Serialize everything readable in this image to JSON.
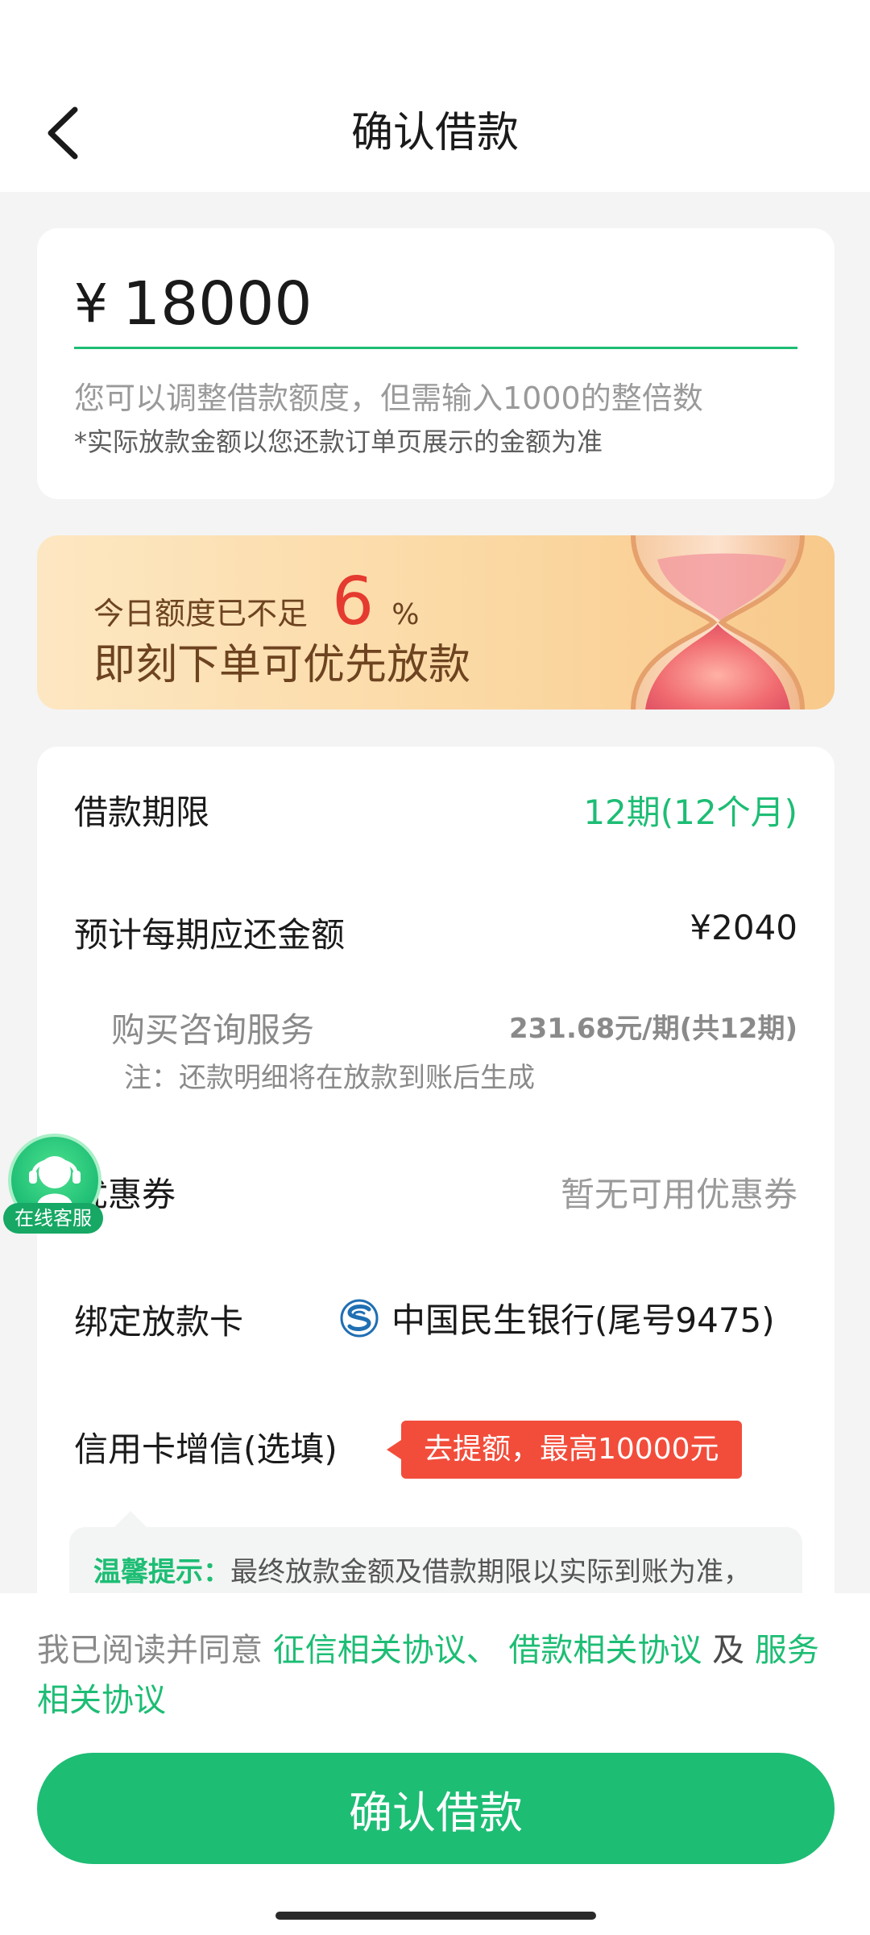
{
  "header": {
    "title": "确认借款"
  },
  "amount": {
    "currency": "¥",
    "value": "18000",
    "hint": "您可以调整借款额度，但需输入1000的整倍数",
    "note": "*实际放款金额以您还款订单页展示的金额为准"
  },
  "promo": {
    "line1": "今日额度已不足",
    "percent": "6",
    "percent_sign": "%",
    "line2": "即刻下单可优先放款"
  },
  "details": {
    "term_label": "借款期限",
    "term_value": "12期(12个月)",
    "monthly_label": "预计每期应还金额",
    "monthly_value": "¥2040",
    "service_label": "购买咨询服务",
    "service_value": "231.68元/期(共12期)",
    "service_note": "注：还款明细将在放款到账后生成",
    "coupon_label": "优惠券",
    "coupon_value": "暂无可用优惠券",
    "card_label": "绑定放款卡",
    "card_value": "中国民生银行(尾号9475)",
    "credit_label": "信用卡增信(选填)",
    "credit_tag": "去提额，最高10000元",
    "tip_label": "温馨提示：",
    "tip_text": "最终放款金额及借款期限以实际到账为准，"
  },
  "float_service": {
    "label": "在线客服"
  },
  "agreement": {
    "prefix": "我已阅读并同意",
    "link1": "征信相关协议、",
    "link2": "借款相关协议",
    "joiner": "及",
    "link3": "服务相关协议"
  },
  "confirm_button": {
    "label": "确认借款"
  },
  "colors": {
    "accent": "#1dbd74",
    "warning": "#f24d3b",
    "promo_percent": "#e53a2f"
  }
}
